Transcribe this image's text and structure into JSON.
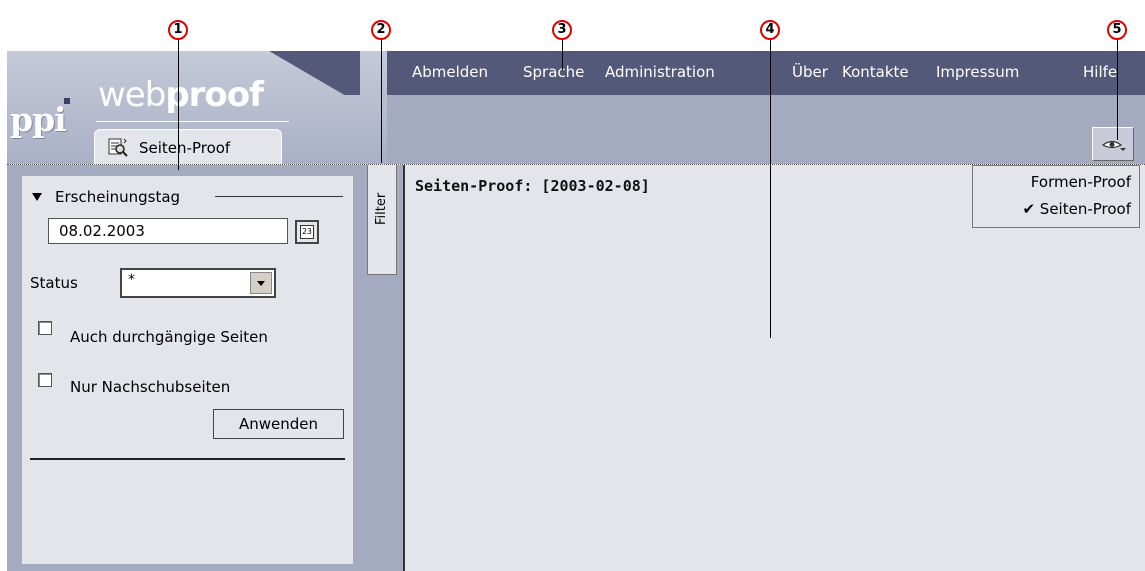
{
  "logo": {
    "company": "ppi",
    "product_prefix": "web",
    "product_suffix": "proof"
  },
  "nav": {
    "items": [
      "Abmelden",
      "Sprache",
      "Administration",
      "Über",
      "Kontakte",
      "Impressum",
      "Hilfe"
    ]
  },
  "tab": {
    "label": "Seiten-Proof"
  },
  "filter_panel": {
    "tab_label": "Filter",
    "section_title": "Erscheinungstag",
    "date_value": "08.02.2003",
    "date_picker_label": "23",
    "status_label": "Status",
    "status_value": "*",
    "checkbox_1_label": "Auch durchgängige Seiten",
    "checkbox_1_checked": false,
    "checkbox_2_label": "Nur Nachschubseiten",
    "checkbox_2_checked": false,
    "apply_label": "Anwenden"
  },
  "main": {
    "title": "Seiten-Proof: [2003-02-08]"
  },
  "view_menu": {
    "items": [
      {
        "label": "Formen-Proof",
        "checked": false
      },
      {
        "label": "Seiten-Proof",
        "checked": true
      }
    ],
    "check_glyph": "✔"
  },
  "callouts": [
    "1",
    "2",
    "3",
    "4",
    "5"
  ],
  "colors": {
    "nav_bg": "#555979",
    "panel_bg": "#a4aac0",
    "content_bg": "#e4e5ea",
    "callout_ring": "#e00000"
  }
}
